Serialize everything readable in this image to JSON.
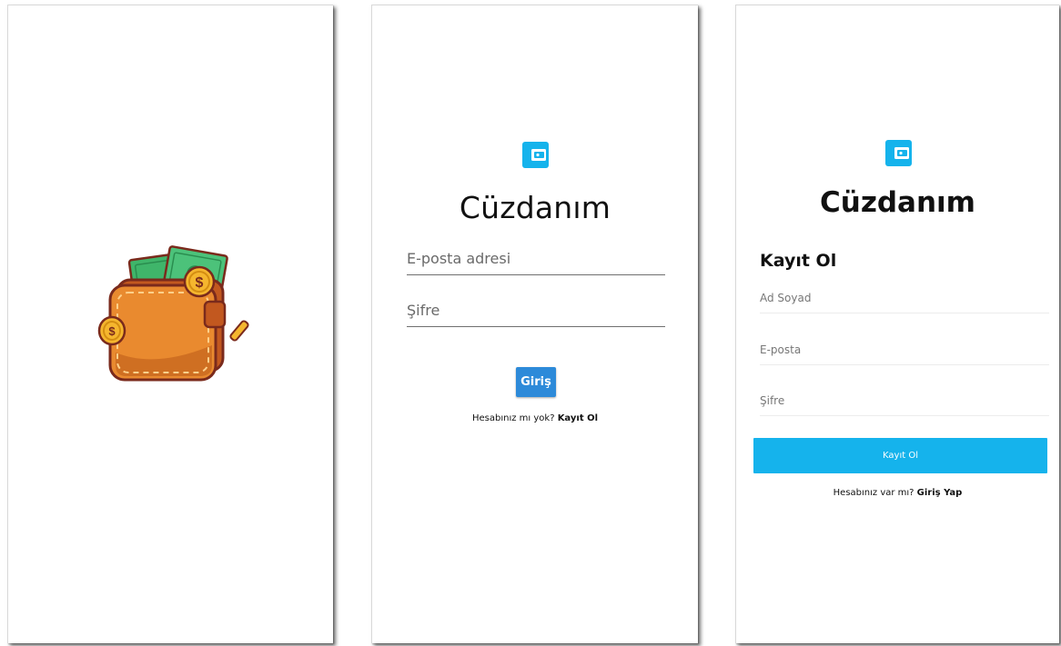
{
  "colors": {
    "accent": "#15b3ec",
    "login_button": "#2d8ad9",
    "text": "#111111"
  },
  "splash": {
    "illustration": "wallet-with-money-and-coins-illustration"
  },
  "login": {
    "logo_icon": "wallet-icon",
    "title": "Cüzdanım",
    "email_placeholder": "E-posta adresi",
    "password_placeholder": "Şifre",
    "submit_label": "Giriş",
    "prompt_text": "Hesabınız mı yok? ",
    "prompt_link": "Kayıt Ol"
  },
  "signup": {
    "logo_icon": "wallet-icon",
    "title": "Cüzdanım",
    "heading": "Kayıt Ol",
    "name_placeholder": "Ad Soyad",
    "email_placeholder": "E-posta",
    "password_placeholder": "Şifre",
    "submit_label": "Kayıt Ol",
    "prompt_text": "Hesabınız var mı? ",
    "prompt_link": "Giriş Yap"
  }
}
